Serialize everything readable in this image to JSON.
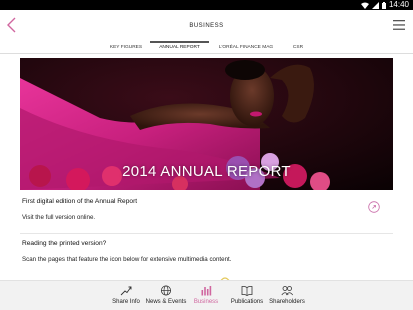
{
  "status_bar": {
    "time": "14:40"
  },
  "header": {
    "title": "BUSINESS"
  },
  "tabs": [
    {
      "label": "KEY FIGURES",
      "active": false
    },
    {
      "label": "ANNUAL REPORT",
      "active": true
    },
    {
      "label": "L'ORÉAL FINANCE MAG",
      "active": false
    },
    {
      "label": "CSR",
      "active": false
    }
  ],
  "hero": {
    "title": "2014 ANNUAL REPORT"
  },
  "content": {
    "digital": {
      "heading": "First digital edition of the Annual Report",
      "text": "Visit the full version online."
    },
    "printed": {
      "heading": "Reading the printed version?",
      "text": "Scan the pages that feature the icon below for extensive multimedia content."
    }
  },
  "bottom_nav": [
    {
      "label": "Share Info",
      "icon": "trend-line-icon",
      "active": false
    },
    {
      "label": "News & Events",
      "icon": "globe-icon",
      "active": false
    },
    {
      "label": "Business",
      "icon": "bar-chart-icon",
      "active": true
    },
    {
      "label": "Publications",
      "icon": "open-book-icon",
      "active": false
    },
    {
      "label": "Shareholders",
      "icon": "people-icon",
      "active": false
    }
  ],
  "colors": {
    "accent": "#d0669f",
    "link_circle": "#c96ba8",
    "status_bar": "#000000"
  }
}
